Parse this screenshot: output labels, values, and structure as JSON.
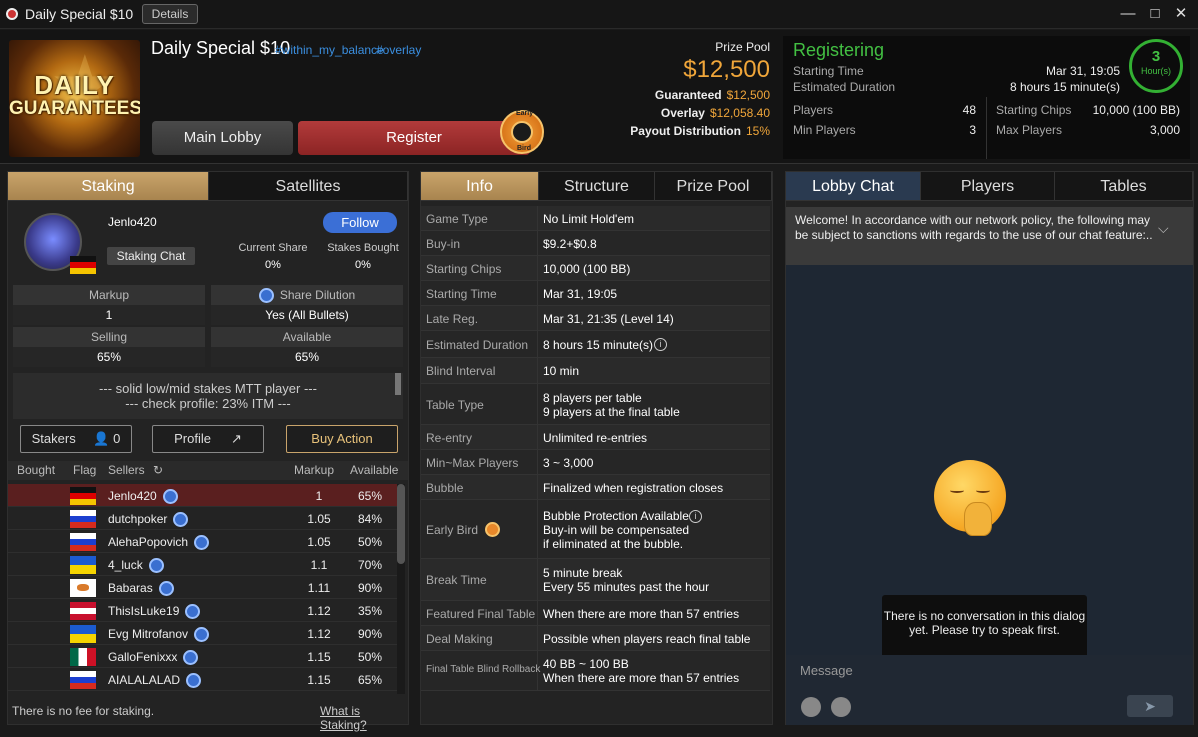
{
  "window": {
    "title": "Daily Special $10",
    "details_label": "Details"
  },
  "tournament": {
    "name": "Daily Special $10",
    "tags": [
      "#within_my_balance",
      "#overlay"
    ],
    "banner_line1": "DAILY",
    "banner_line2": "GUARANTEES"
  },
  "buttons": {
    "main_lobby": "Main Lobby",
    "register": "Register",
    "early_bird_top": "Early",
    "early_bird_bottom": "Bird"
  },
  "prize": {
    "label": "Prize Pool",
    "amount": "$12,500",
    "guaranteed_label": "Guaranteed",
    "guaranteed_value": "$12,500",
    "overlay_label": "Overlay",
    "overlay_value": "$12,058.40",
    "payout_label": "Payout Distribution",
    "payout_value": "15%"
  },
  "status": {
    "state": "Registering",
    "starting_time_label": "Starting Time",
    "starting_time_value": "Mar 31, 19:05",
    "est_duration_label": "Estimated Duration",
    "est_duration_value": "8 hours 15 minute(s)",
    "hours_number": "3",
    "hours_unit": "Hour(s)",
    "players_label": "Players",
    "players_value": "48",
    "min_players_label": "Min Players",
    "min_players_value": "3",
    "starting_chips_label": "Starting Chips",
    "starting_chips_value": "10,000 (100 BB)",
    "max_players_label": "Max Players",
    "max_players_value": "3,000"
  },
  "left": {
    "tabs": [
      "Staking",
      "Satellites"
    ],
    "username": "Jenlo420",
    "follow": "Follow",
    "staking_chat": "Staking Chat",
    "current_share_label": "Current Share",
    "current_share_value": "0%",
    "stakes_bought_label": "Stakes Bought",
    "stakes_bought_value": "0%",
    "markup_label": "Markup",
    "markup_value": "1",
    "share_dilution_label": "Share Dilution",
    "share_dilution_value": "Yes (All Bullets)",
    "selling_label": "Selling",
    "selling_value": "65%",
    "available_label": "Available",
    "available_value": "65%",
    "bio_line1": "--- solid low/mid stakes MTT player ---",
    "bio_line2": "--- check profile: 23% ITM ---",
    "stakers_label": "Stakers",
    "stakers_count": "0",
    "profile_label": "Profile",
    "buy_action_label": "Buy Action",
    "columns": [
      "Bought",
      "Flag",
      "Sellers",
      "Markup",
      "Available"
    ],
    "rows": [
      {
        "flag": "de",
        "name": "Jenlo420",
        "markup": "1",
        "available": "65%"
      },
      {
        "flag": "ru",
        "name": "dutchpoker",
        "markup": "1.05",
        "available": "84%"
      },
      {
        "flag": "ru",
        "name": "AlehaPopovich",
        "markup": "1.05",
        "available": "50%"
      },
      {
        "flag": "ua",
        "name": "4_luck",
        "markup": "1.1",
        "available": "70%"
      },
      {
        "flag": "cy",
        "name": "Babaras",
        "markup": "1.11",
        "available": "90%"
      },
      {
        "flag": "at",
        "name": "ThisIsLuke19",
        "markup": "1.12",
        "available": "35%"
      },
      {
        "flag": "ua",
        "name": "Evg Mitrofanov",
        "markup": "1.12",
        "available": "90%"
      },
      {
        "flag": "mx",
        "name": "GalloFenixxx",
        "markup": "1.15",
        "available": "50%"
      },
      {
        "flag": "ru",
        "name": "AIALALALAD",
        "markup": "1.15",
        "available": "65%"
      }
    ],
    "footer_note": "There is no fee for staking.",
    "footer_link": "What is Staking?"
  },
  "middle": {
    "tabs": [
      "Info",
      "Structure",
      "Prize Pool"
    ],
    "rows": [
      {
        "k": "Game Type",
        "v1": "No Limit Hold'em",
        "v2": ""
      },
      {
        "k": "Buy-in",
        "v1": "$9.2+$0.8",
        "v2": ""
      },
      {
        "k": "Starting Chips",
        "v1": "10,000 (100 BB)",
        "v2": ""
      },
      {
        "k": "Starting Time",
        "v1": "Mar 31, 19:05",
        "v2": ""
      },
      {
        "k": "Late Reg.",
        "v1": "Mar 31, 21:35 (Level 14)",
        "v2": ""
      },
      {
        "k": "Estimated Duration",
        "v1": "8 hours 15 minute(s)",
        "v2": ""
      },
      {
        "k": "Blind Interval",
        "v1": "10 min",
        "v2": ""
      },
      {
        "k": "Table Type",
        "v1": "8 players per table",
        "v2": "9 players at the final table"
      },
      {
        "k": "Re-entry",
        "v1": "Unlimited re-entries",
        "v2": ""
      },
      {
        "k": "Min~Max Players",
        "v1": "3 ~ 3,000",
        "v2": ""
      },
      {
        "k": "Bubble",
        "v1": "Finalized when registration closes",
        "v2": ""
      },
      {
        "k": "Early Bird",
        "v1": "Bubble Protection Available",
        "v2": "Buy-in will be compensated",
        "v3": " if eliminated at the bubble."
      },
      {
        "k": "Break Time",
        "v1": "5 minute break",
        "v2": "Every 55 minutes past the hour"
      },
      {
        "k": "Featured Final Table",
        "v1": "When there are more than 57 entries",
        "v2": ""
      },
      {
        "k": "Deal Making",
        "v1": "Possible when players reach final table",
        "v2": ""
      },
      {
        "k": "Final Table Blind Rollback",
        "v1": "40 BB ~ 100 BB",
        "v2": "When there are more than 57 entries"
      }
    ]
  },
  "right": {
    "tabs": [
      "Lobby Chat",
      "Players",
      "Tables"
    ],
    "welcome": "Welcome! In accordance with our network policy, the following may be subject to sanctions with regards to the use of our chat feature:..",
    "empty_message": "There is no conversation in this dialog yet. Please try to speak first.",
    "message_placeholder": "Message"
  }
}
